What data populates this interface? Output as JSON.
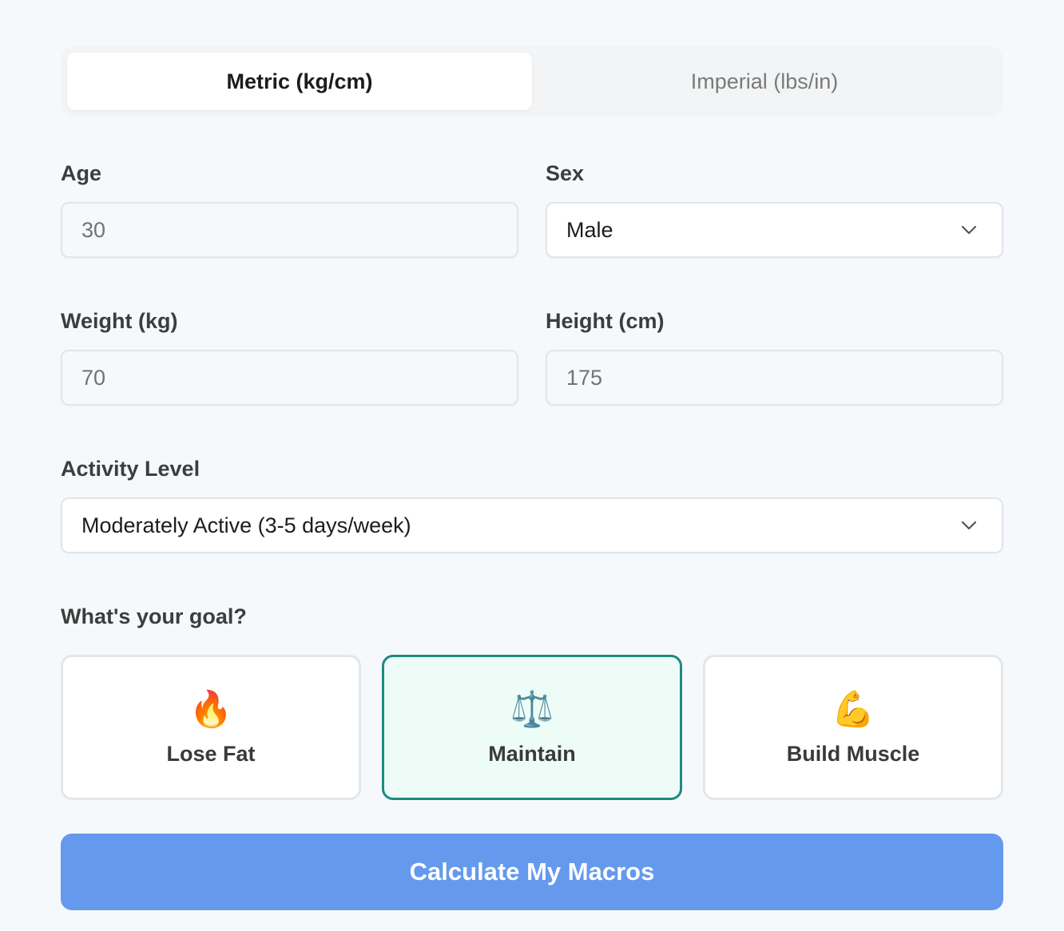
{
  "units": {
    "metric_label": "Metric (kg/cm)",
    "imperial_label": "Imperial (lbs/in)",
    "active": "metric"
  },
  "fields": {
    "age": {
      "label": "Age",
      "placeholder": "30"
    },
    "sex": {
      "label": "Sex",
      "value": "Male"
    },
    "weight": {
      "label": "Weight (kg)",
      "placeholder": "70"
    },
    "height": {
      "label": "Height (cm)",
      "placeholder": "175"
    },
    "activity": {
      "label": "Activity Level",
      "value": "Moderately Active (3-5 days/week)"
    }
  },
  "goal": {
    "question": "What's your goal?",
    "options": [
      {
        "icon": "🔥",
        "icon_name": "fire-icon",
        "label": "Lose Fat",
        "selected": false
      },
      {
        "icon": "⚖️",
        "icon_name": "scales-icon",
        "label": "Maintain",
        "selected": true
      },
      {
        "icon": "💪",
        "icon_name": "flexed-biceps-icon",
        "label": "Build Muscle",
        "selected": false
      }
    ]
  },
  "submit_label": "Calculate My Macros",
  "colors": {
    "accent": "#6499ee",
    "selected_border": "#1d8a80",
    "selected_bg": "#edfcf7"
  }
}
